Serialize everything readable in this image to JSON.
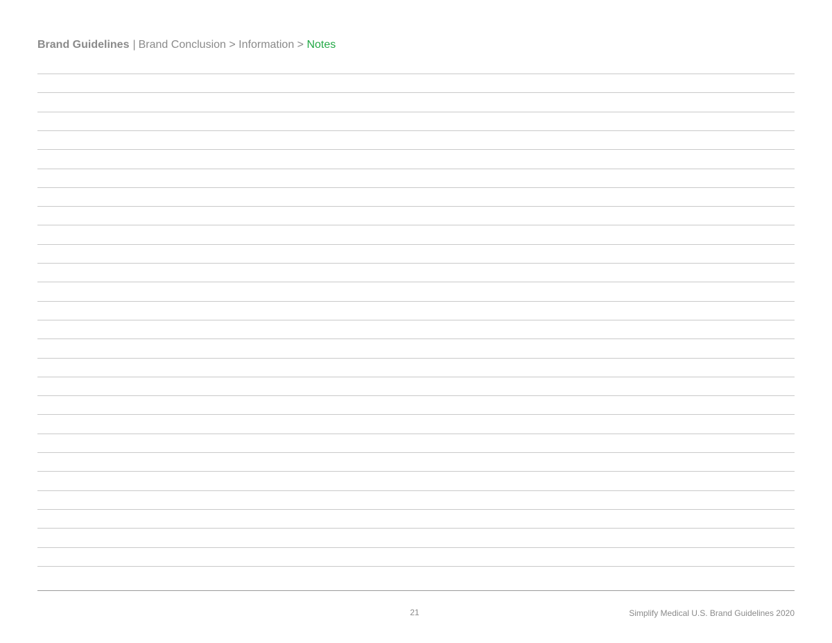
{
  "header": {
    "doc_title": "Brand Guidelines",
    "separator": "|",
    "breadcrumb": [
      {
        "label": "Brand Conclusion"
      },
      {
        "label": "Information"
      },
      {
        "label": "Notes"
      }
    ],
    "crumb_separator": ">",
    "current_color": "#22a845"
  },
  "notes": {
    "line_count": 27
  },
  "footer": {
    "page_number": "21",
    "document_name": "Simplify Medical U.S. Brand Guidelines 2020"
  }
}
